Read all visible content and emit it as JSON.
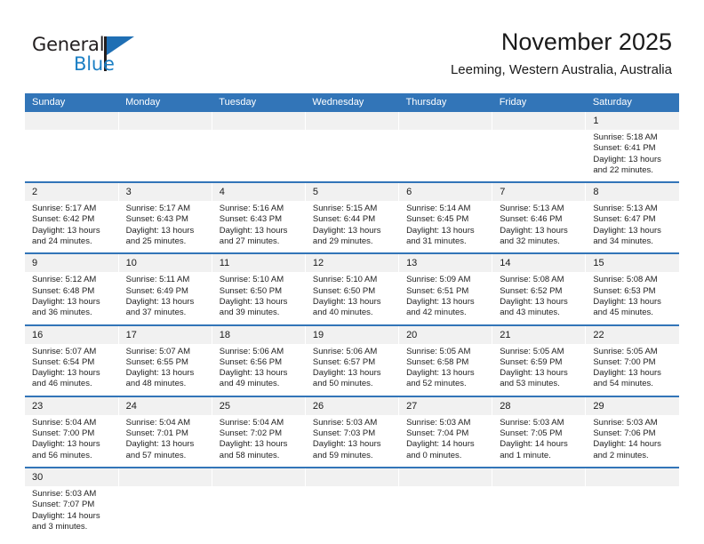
{
  "brand": {
    "name_top": "General",
    "name_bottom": "Blue",
    "flag_color": "#1f6fb4",
    "text_color": "#231f20",
    "blue_text_color": "#1b7fc4"
  },
  "header": {
    "title": "November 2025",
    "subtitle": "Leeming, Western Australia, Australia",
    "accent_color": "#3275b8"
  },
  "calendar": {
    "weekday_headers": [
      "Sunday",
      "Monday",
      "Tuesday",
      "Wednesday",
      "Thursday",
      "Friday",
      "Saturday"
    ],
    "daynum_band_color": "#f1f1f1",
    "weeks": [
      [
        {
          "day": "",
          "lines": []
        },
        {
          "day": "",
          "lines": []
        },
        {
          "day": "",
          "lines": []
        },
        {
          "day": "",
          "lines": []
        },
        {
          "day": "",
          "lines": []
        },
        {
          "day": "",
          "lines": []
        },
        {
          "day": "1",
          "lines": [
            "Sunrise: 5:18 AM",
            "Sunset: 6:41 PM",
            "Daylight: 13 hours",
            "and 22 minutes."
          ]
        }
      ],
      [
        {
          "day": "2",
          "lines": [
            "Sunrise: 5:17 AM",
            "Sunset: 6:42 PM",
            "Daylight: 13 hours",
            "and 24 minutes."
          ]
        },
        {
          "day": "3",
          "lines": [
            "Sunrise: 5:17 AM",
            "Sunset: 6:43 PM",
            "Daylight: 13 hours",
            "and 25 minutes."
          ]
        },
        {
          "day": "4",
          "lines": [
            "Sunrise: 5:16 AM",
            "Sunset: 6:43 PM",
            "Daylight: 13 hours",
            "and 27 minutes."
          ]
        },
        {
          "day": "5",
          "lines": [
            "Sunrise: 5:15 AM",
            "Sunset: 6:44 PM",
            "Daylight: 13 hours",
            "and 29 minutes."
          ]
        },
        {
          "day": "6",
          "lines": [
            "Sunrise: 5:14 AM",
            "Sunset: 6:45 PM",
            "Daylight: 13 hours",
            "and 31 minutes."
          ]
        },
        {
          "day": "7",
          "lines": [
            "Sunrise: 5:13 AM",
            "Sunset: 6:46 PM",
            "Daylight: 13 hours",
            "and 32 minutes."
          ]
        },
        {
          "day": "8",
          "lines": [
            "Sunrise: 5:13 AM",
            "Sunset: 6:47 PM",
            "Daylight: 13 hours",
            "and 34 minutes."
          ]
        }
      ],
      [
        {
          "day": "9",
          "lines": [
            "Sunrise: 5:12 AM",
            "Sunset: 6:48 PM",
            "Daylight: 13 hours",
            "and 36 minutes."
          ]
        },
        {
          "day": "10",
          "lines": [
            "Sunrise: 5:11 AM",
            "Sunset: 6:49 PM",
            "Daylight: 13 hours",
            "and 37 minutes."
          ]
        },
        {
          "day": "11",
          "lines": [
            "Sunrise: 5:10 AM",
            "Sunset: 6:50 PM",
            "Daylight: 13 hours",
            "and 39 minutes."
          ]
        },
        {
          "day": "12",
          "lines": [
            "Sunrise: 5:10 AM",
            "Sunset: 6:50 PM",
            "Daylight: 13 hours",
            "and 40 minutes."
          ]
        },
        {
          "day": "13",
          "lines": [
            "Sunrise: 5:09 AM",
            "Sunset: 6:51 PM",
            "Daylight: 13 hours",
            "and 42 minutes."
          ]
        },
        {
          "day": "14",
          "lines": [
            "Sunrise: 5:08 AM",
            "Sunset: 6:52 PM",
            "Daylight: 13 hours",
            "and 43 minutes."
          ]
        },
        {
          "day": "15",
          "lines": [
            "Sunrise: 5:08 AM",
            "Sunset: 6:53 PM",
            "Daylight: 13 hours",
            "and 45 minutes."
          ]
        }
      ],
      [
        {
          "day": "16",
          "lines": [
            "Sunrise: 5:07 AM",
            "Sunset: 6:54 PM",
            "Daylight: 13 hours",
            "and 46 minutes."
          ]
        },
        {
          "day": "17",
          "lines": [
            "Sunrise: 5:07 AM",
            "Sunset: 6:55 PM",
            "Daylight: 13 hours",
            "and 48 minutes."
          ]
        },
        {
          "day": "18",
          "lines": [
            "Sunrise: 5:06 AM",
            "Sunset: 6:56 PM",
            "Daylight: 13 hours",
            "and 49 minutes."
          ]
        },
        {
          "day": "19",
          "lines": [
            "Sunrise: 5:06 AM",
            "Sunset: 6:57 PM",
            "Daylight: 13 hours",
            "and 50 minutes."
          ]
        },
        {
          "day": "20",
          "lines": [
            "Sunrise: 5:05 AM",
            "Sunset: 6:58 PM",
            "Daylight: 13 hours",
            "and 52 minutes."
          ]
        },
        {
          "day": "21",
          "lines": [
            "Sunrise: 5:05 AM",
            "Sunset: 6:59 PM",
            "Daylight: 13 hours",
            "and 53 minutes."
          ]
        },
        {
          "day": "22",
          "lines": [
            "Sunrise: 5:05 AM",
            "Sunset: 7:00 PM",
            "Daylight: 13 hours",
            "and 54 minutes."
          ]
        }
      ],
      [
        {
          "day": "23",
          "lines": [
            "Sunrise: 5:04 AM",
            "Sunset: 7:00 PM",
            "Daylight: 13 hours",
            "and 56 minutes."
          ]
        },
        {
          "day": "24",
          "lines": [
            "Sunrise: 5:04 AM",
            "Sunset: 7:01 PM",
            "Daylight: 13 hours",
            "and 57 minutes."
          ]
        },
        {
          "day": "25",
          "lines": [
            "Sunrise: 5:04 AM",
            "Sunset: 7:02 PM",
            "Daylight: 13 hours",
            "and 58 minutes."
          ]
        },
        {
          "day": "26",
          "lines": [
            "Sunrise: 5:03 AM",
            "Sunset: 7:03 PM",
            "Daylight: 13 hours",
            "and 59 minutes."
          ]
        },
        {
          "day": "27",
          "lines": [
            "Sunrise: 5:03 AM",
            "Sunset: 7:04 PM",
            "Daylight: 14 hours",
            "and 0 minutes."
          ]
        },
        {
          "day": "28",
          "lines": [
            "Sunrise: 5:03 AM",
            "Sunset: 7:05 PM",
            "Daylight: 14 hours",
            "and 1 minute."
          ]
        },
        {
          "day": "29",
          "lines": [
            "Sunrise: 5:03 AM",
            "Sunset: 7:06 PM",
            "Daylight: 14 hours",
            "and 2 minutes."
          ]
        }
      ],
      [
        {
          "day": "30",
          "lines": [
            "Sunrise: 5:03 AM",
            "Sunset: 7:07 PM",
            "Daylight: 14 hours",
            "and 3 minutes."
          ]
        },
        {
          "day": "",
          "lines": []
        },
        {
          "day": "",
          "lines": []
        },
        {
          "day": "",
          "lines": []
        },
        {
          "day": "",
          "lines": []
        },
        {
          "day": "",
          "lines": []
        },
        {
          "day": "",
          "lines": []
        }
      ]
    ]
  }
}
